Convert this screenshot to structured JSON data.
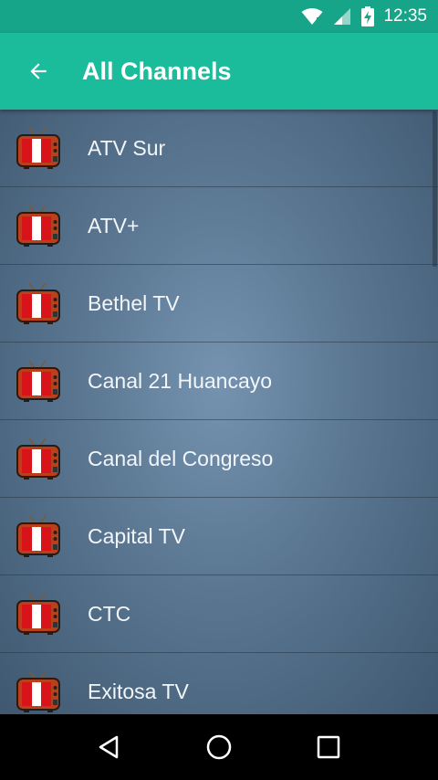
{
  "status_bar": {
    "time": "12:35",
    "icons": [
      "wifi-icon",
      "signal-icon",
      "battery-charging-icon"
    ]
  },
  "app_bar": {
    "title": "All Channels",
    "back_icon": "arrow-back-icon"
  },
  "channels": [
    {
      "label": "ATV Sur",
      "icon": "tv-peru-flag-icon"
    },
    {
      "label": "ATV+",
      "icon": "tv-peru-flag-icon"
    },
    {
      "label": "Bethel TV",
      "icon": "tv-peru-flag-icon"
    },
    {
      "label": "Canal 21 Huancayo",
      "icon": "tv-peru-flag-icon"
    },
    {
      "label": "Canal del Congreso",
      "icon": "tv-peru-flag-icon"
    },
    {
      "label": "Capital TV",
      "icon": "tv-peru-flag-icon"
    },
    {
      "label": "CTC",
      "icon": "tv-peru-flag-icon"
    },
    {
      "label": "Exitosa TV",
      "icon": "tv-peru-flag-icon"
    }
  ],
  "nav_bar": {
    "buttons": [
      "back-triangle-icon",
      "home-circle-icon",
      "recents-square-icon"
    ]
  },
  "colors": {
    "status_bar": "#17a589",
    "app_bar": "#1abc9c",
    "list_bg": "#5a7691"
  }
}
